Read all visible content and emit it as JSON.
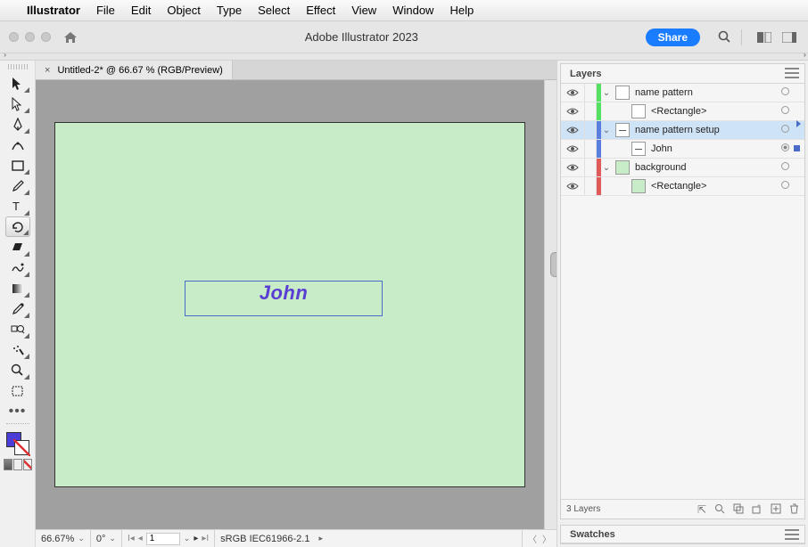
{
  "menubar": {
    "apple": "",
    "app": "Illustrator",
    "items": [
      "File",
      "Edit",
      "Object",
      "Type",
      "Select",
      "Effect",
      "View",
      "Window",
      "Help"
    ]
  },
  "window": {
    "title": "Adobe Illustrator 2023",
    "share": "Share"
  },
  "document": {
    "tab_label": "Untitled-2* @ 66.67 % (RGB/Preview)",
    "canvas_text": "John"
  },
  "statusbar": {
    "zoom": "66.67%",
    "rotate": "0°",
    "artboard_num": "1",
    "color_profile": "sRGB IEC61966-2.1"
  },
  "layers_panel": {
    "title": "Layers",
    "footer": "3 Layers",
    "rows": [
      {
        "name": "name pattern",
        "color": "#54e060",
        "depth": 0,
        "disclose": "v",
        "thumb": "white",
        "eye": true,
        "target": "ring",
        "sel": ""
      },
      {
        "name": "<Rectangle>",
        "color": "#54e060",
        "depth": 1,
        "disclose": "",
        "thumb": "white",
        "eye": true,
        "target": "ring",
        "sel": ""
      },
      {
        "name": "name pattern setup",
        "color": "#5a7de0",
        "depth": 0,
        "disclose": "v",
        "thumb": "mini",
        "eye": true,
        "target": "ring",
        "sel": "tri",
        "selected": true
      },
      {
        "name": "John",
        "color": "#5a7de0",
        "depth": 1,
        "disclose": "",
        "thumb": "mini",
        "eye": true,
        "target": "filled",
        "sel": "sq"
      },
      {
        "name": "background",
        "color": "#e05a5a",
        "depth": 0,
        "disclose": "v",
        "thumb": "green",
        "eye": true,
        "target": "ring",
        "sel": ""
      },
      {
        "name": "<Rectangle>",
        "color": "#e05a5a",
        "depth": 1,
        "disclose": "",
        "thumb": "green",
        "eye": true,
        "target": "ring",
        "sel": ""
      }
    ]
  },
  "swatches_panel": {
    "title": "Swatches"
  },
  "tools": [
    "selection",
    "direct-selection",
    "pen",
    "curvature",
    "rectangle",
    "paintbrush",
    "type",
    "rotate",
    "eraser",
    "free-transform",
    "gradient",
    "eyedropper",
    "blend",
    "symbol-sprayer",
    "column-graph",
    "zoom",
    "artboard"
  ]
}
